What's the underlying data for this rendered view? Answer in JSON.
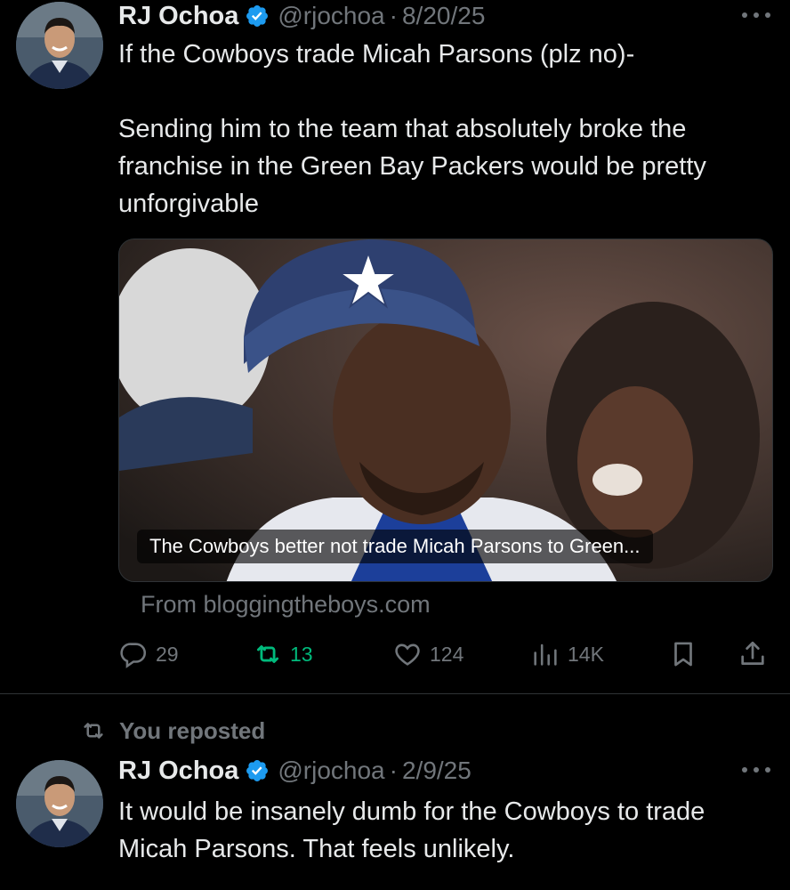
{
  "tweet1": {
    "author_name": "RJ Ochoa",
    "handle": "@rjochoa",
    "separator": "·",
    "date": "8/20/25",
    "text": "If the Cowboys trade Micah Parsons (plz no)-\n\nSending him to the team that absolutely broke the franchise in the Green Bay Packers would be pretty unforgivable",
    "card": {
      "title": "The Cowboys better not trade Micah Parsons to Green...",
      "source": "From bloggingtheboys.com"
    },
    "actions": {
      "replies": "29",
      "reposts": "13",
      "likes": "124",
      "views": "14K"
    }
  },
  "repost_banner": {
    "label": "You reposted"
  },
  "tweet2": {
    "author_name": "RJ Ochoa",
    "handle": "@rjochoa",
    "separator": "·",
    "date": "2/9/25",
    "text": "It would be insanely dumb for the Cowboys to trade Micah Parsons. That feels unlikely."
  },
  "colors": {
    "background": "#000000",
    "text": "#e7e9ea",
    "muted": "#71767b",
    "verified": "#1d9bf0",
    "repost_active": "#00ba7c",
    "divider": "#2f3336"
  },
  "icons": {
    "reply": "reply-icon",
    "repost": "repost-icon",
    "like": "heart-icon",
    "views": "views-icon",
    "bookmark": "bookmark-icon",
    "share": "share-icon",
    "verified": "verified-badge-icon",
    "more": "more-icon"
  }
}
